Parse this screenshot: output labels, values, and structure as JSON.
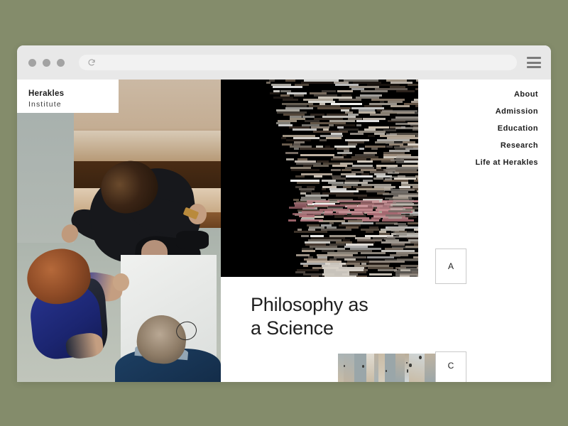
{
  "background_color": "#848c6b",
  "browser": {
    "traffic_lights": [
      "close",
      "minimize",
      "maximize"
    ],
    "address_bar": {
      "value": "",
      "placeholder": "",
      "reload_icon": "reload-icon"
    },
    "menu_icon": "hamburger-menu-icon"
  },
  "site": {
    "logo": {
      "title": "Herakles",
      "subtitle": "Institute"
    },
    "nav": {
      "items": [
        {
          "label": "About"
        },
        {
          "label": "Admission"
        },
        {
          "label": "Education"
        },
        {
          "label": "Research"
        },
        {
          "label": "Life at Herakles"
        }
      ]
    },
    "hero": {
      "headline_line1": "Philosophy as",
      "headline_line2": "a Science",
      "left_image": "overhead-photo-people-at-table",
      "center_image": "glitch-pixel-sort-abstract",
      "thumbnail_image": "stone-texture-thumbnail"
    },
    "letter_cards": [
      {
        "label": "A"
      },
      {
        "label": "C"
      }
    ]
  },
  "colors": {
    "page_background": "#848c6b",
    "chrome_background": "#e8e8e8",
    "address_bar_background": "#f2f2f2",
    "content_background": "#ffffff",
    "text_primary": "#1d1d1d",
    "glitch_accent_pink": "#c98b92"
  }
}
